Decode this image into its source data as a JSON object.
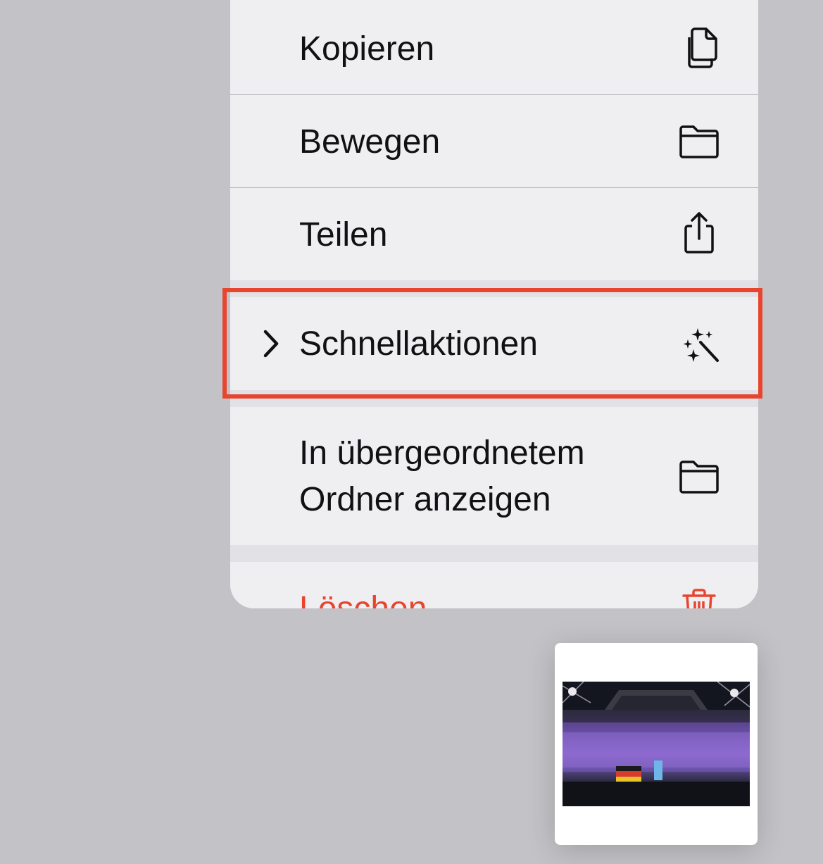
{
  "menu": {
    "items": [
      {
        "label": "Kopieren",
        "icon": "copy-icon"
      },
      {
        "label": "Bewegen",
        "icon": "folder-icon"
      },
      {
        "label": "Teilen",
        "icon": "share-icon"
      },
      {
        "label": "Schnellaktionen",
        "icon": "magic-wand-icon",
        "has_submenu": true,
        "highlighted": true
      },
      {
        "label_line1": "In übergeordnetem",
        "label_line2": "Ordner anzeigen",
        "icon": "folder-icon"
      },
      {
        "label": "Löschen",
        "icon": "trash-icon",
        "color": "#e8452e"
      }
    ]
  },
  "colors": {
    "background": "#c3c3c7",
    "menu_row": "#efeff2",
    "menu_group_gap": "#e2e2e6",
    "destructive": "#e8452e",
    "highlight_border": "#e8452e"
  },
  "thumbnail": {
    "icon": "photo-thumbnail"
  }
}
